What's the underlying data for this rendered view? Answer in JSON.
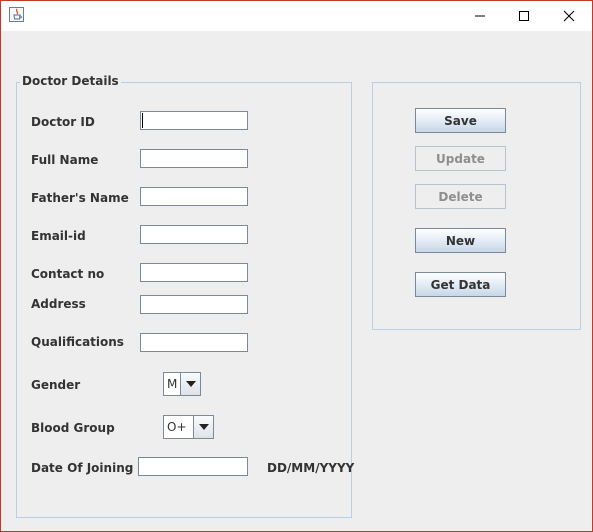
{
  "window": {
    "title": "",
    "app_icon": "java-cup-icon"
  },
  "form": {
    "group_title": "Doctor Details",
    "doctor_id": {
      "label": "Doctor ID",
      "value": ""
    },
    "full_name": {
      "label": "Full Name",
      "value": ""
    },
    "fathers_name": {
      "label": "Father's Name",
      "value": ""
    },
    "email": {
      "label": "Email-id",
      "value": ""
    },
    "contact": {
      "label": "Contact no",
      "value": ""
    },
    "address": {
      "label": "Address",
      "value": ""
    },
    "qualifications": {
      "label": "Qualifications",
      "value": ""
    },
    "gender": {
      "label": "Gender",
      "selected": "M"
    },
    "blood_group": {
      "label": "Blood Group",
      "selected": "O+"
    },
    "date_of_joining": {
      "label": "Date Of Joining",
      "value": "",
      "format_hint": "DD/MM/YYYY"
    }
  },
  "actions": {
    "save": {
      "label": "Save",
      "enabled": true
    },
    "update": {
      "label": "Update",
      "enabled": false
    },
    "delete": {
      "label": "Delete",
      "enabled": false
    },
    "new": {
      "label": "New",
      "enabled": true
    },
    "get_data": {
      "label": "Get Data",
      "enabled": true
    }
  },
  "colors": {
    "window_border": "#c0392b",
    "panel_background": "#eeeeee",
    "group_border": "#b8cfe5",
    "button_gradient_end": "#c8d6e6",
    "disabled_text": "#8e8e8e"
  }
}
